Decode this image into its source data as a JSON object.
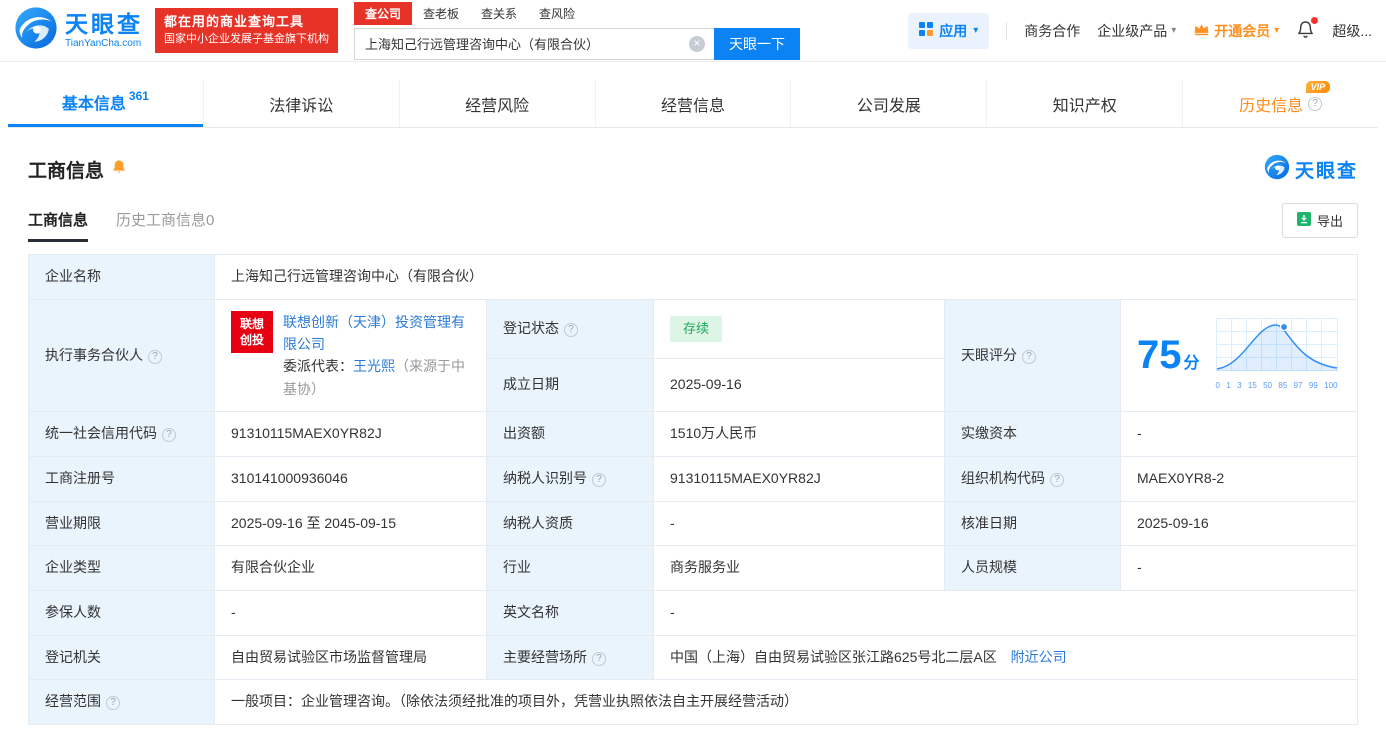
{
  "icons": {
    "caret_down": "▾",
    "clear": "×",
    "help": "?"
  },
  "header": {
    "brand": {
      "name": "天眼查",
      "domain": "TianYanCha.com"
    },
    "slogan": {
      "line1": "都在用的商业查询工具",
      "line2": "国家中小企业发展子基金旗下机构"
    },
    "search": {
      "tabs": [
        "查公司",
        "查老板",
        "查关系",
        "查风险"
      ],
      "value": "上海知己行远管理咨询中心（有限合伙）",
      "button": "天眼一下"
    },
    "nav": {
      "apps": "应用",
      "cooperation": "商务合作",
      "enterprise": "企业级产品",
      "membership": "开通会员",
      "super_vip": "超级..."
    }
  },
  "tabs": [
    {
      "label": "基本信息",
      "count": "361"
    },
    {
      "label": "法律诉讼"
    },
    {
      "label": "经营风险"
    },
    {
      "label": "经营信息"
    },
    {
      "label": "公司发展"
    },
    {
      "label": "知识产权"
    },
    {
      "label": "历史信息",
      "vip": "VIP"
    }
  ],
  "section": {
    "title": "工商信息",
    "brand": "天眼查",
    "subtab_active": "工商信息",
    "subtab_history": "历史工商信息0",
    "export": "导出"
  },
  "info": {
    "company_name_label": "企业名称",
    "company_name": "上海知己行远管理咨询中心（有限合伙）",
    "partner_label": "执行事务合伙人",
    "partner_logo_line1": "联想",
    "partner_logo_line2": "创投",
    "partner_company": "联想创新（天津）投资管理有限公司",
    "delegate_prefix": "委派代表：",
    "delegate_name": "王光熙",
    "delegate_note": "（来源于中基协）",
    "reg_status_label": "登记状态",
    "reg_status": "存续",
    "establish_label": "成立日期",
    "establish_date": "2025-09-16",
    "score_label": "天眼评分",
    "score": "75",
    "score_unit": "分",
    "score_axis": [
      "0",
      "1",
      "3",
      "15",
      "50",
      "85",
      "97",
      "99",
      "100"
    ],
    "credit_code_label": "统一社会信用代码",
    "credit_code": "91310115MAEX0YR82J",
    "capital_label": "出资额",
    "capital": "1510万人民币",
    "paid_capital_label": "实缴资本",
    "paid_capital": "-",
    "reg_no_label": "工商注册号",
    "reg_no": "310141000936046",
    "taxpayer_id_label": "纳税人识别号",
    "taxpayer_id": "91310115MAEX0YR82J",
    "org_code_label": "组织机构代码",
    "org_code": "MAEX0YR8-2",
    "term_label": "营业期限",
    "term": "2025-09-16 至 2045-09-15",
    "taxpayer_quality_label": "纳税人资质",
    "taxpayer_quality": "-",
    "approval_label": "核准日期",
    "approval_date": "2025-09-16",
    "company_type_label": "企业类型",
    "company_type": "有限合伙企业",
    "industry_label": "行业",
    "industry": "商务服务业",
    "staff_label": "人员规模",
    "staff": "-",
    "insured_label": "参保人数",
    "insured": "-",
    "english_label": "英文名称",
    "english_name": "-",
    "authority_label": "登记机关",
    "authority": "自由贸易试验区市场监督管理局",
    "address_label": "主要经营场所",
    "address": "中国（上海）自由贸易试验区张江路625号北二层A区",
    "nearby": "附近公司",
    "scope_label": "经营范围",
    "scope": "一般项目：企业管理咨询。（除依法须经批准的项目外，凭营业执照依法自主开展经营活动）"
  }
}
